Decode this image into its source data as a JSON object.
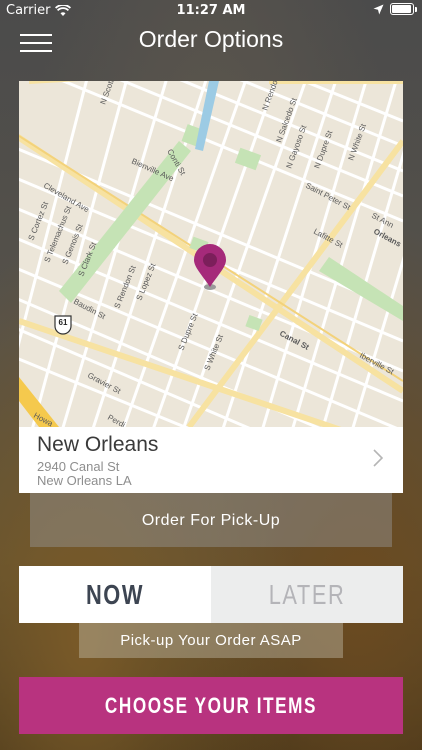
{
  "status_bar": {
    "carrier": "Carrier",
    "time": "11:27 AM",
    "icons": [
      "wifi-icon",
      "location-arrow-icon",
      "battery-icon"
    ],
    "battery_level": 0.95
  },
  "header": {
    "menu_icon": "hamburger-menu-icon",
    "title": "Order Options"
  },
  "map": {
    "street_labels": [
      "N Rendon St",
      "N Scott",
      "N Salcedo St",
      "N Gayoso St",
      "N Dupre St",
      "N White St",
      "Bienville Ave",
      "Conti St",
      "Saint Peter St",
      "Lafitte St",
      "St Ann",
      "Orleans",
      "Cleveland Ave",
      "S Cortez St",
      "S Telemachus St",
      "S Genois St",
      "S Clark St",
      "Baudin St",
      "S Rendon St",
      "S Lopez St",
      "S Dupre St",
      "S White St",
      "Canal St",
      "Iberville St",
      "Gravier St",
      "Perdi",
      "Howa",
      "61"
    ],
    "pin_icon": "map-pin-icon",
    "pin_color": "#a52a7a"
  },
  "location": {
    "name": "New Orleans",
    "address_line1": "2940 Canal St",
    "address_line2": "New Orleans LA",
    "chevron_icon": "chevron-right-icon"
  },
  "order_type": {
    "label": "Order For Pick-Up"
  },
  "timing": {
    "options": [
      "NOW",
      "LATER"
    ],
    "selected": "NOW",
    "hint": "Pick-up Your Order ASAP"
  },
  "cta": {
    "label": "CHOOSE YOUR ITEMS",
    "color": "#b8337f"
  }
}
